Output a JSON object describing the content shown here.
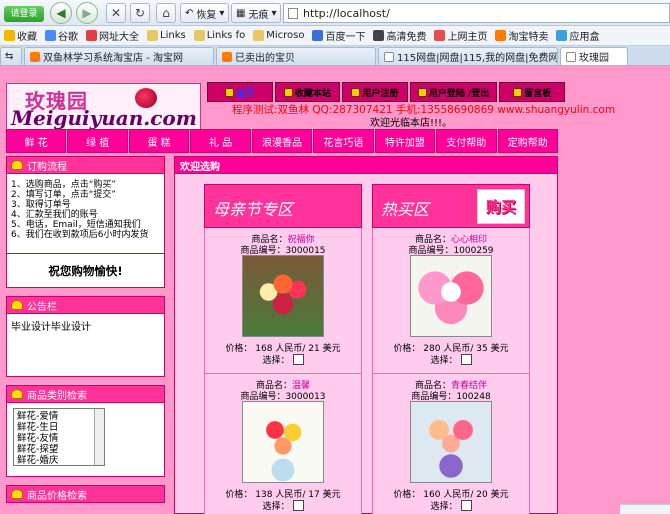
{
  "browser": {
    "login_label": "请登录",
    "back_icon": "back-arrow-icon",
    "forward_icon": "forward-arrow-icon",
    "stop_icon": "close-icon",
    "reload_icon": "reload-icon",
    "home_icon": "home-icon",
    "restore_label": "恢复",
    "no_trace_label": "无痕",
    "url": "http://localhost/",
    "bookmarks": [
      {
        "label": "收藏",
        "color": "#f5b800"
      },
      {
        "label": "谷歌",
        "color": "#4a8af4"
      },
      {
        "label": "网址大全",
        "color": "#e04040"
      },
      {
        "label": "Links",
        "color": "#e8c66a"
      },
      {
        "label": "Links fo",
        "color": "#e8c66a"
      },
      {
        "label": "Microso",
        "color": "#e8c66a"
      },
      {
        "label": "百度一下",
        "color": "#3a6fd8"
      },
      {
        "label": "高清免费",
        "color": "#444444"
      },
      {
        "label": "上网主页",
        "color": "#e05050"
      },
      {
        "label": "淘宝特卖",
        "color": "#ff7a00"
      },
      {
        "label": "应用盒",
        "color": "#3aa0e0"
      }
    ],
    "tabs": [
      {
        "label": "双鱼林学习系统淘宝店 - 淘宝网",
        "active": false
      },
      {
        "label": "已卖出的宝贝",
        "active": false
      },
      {
        "label": "115网盘|网盘|115,我的网盘|免费网络...",
        "active": false
      },
      {
        "label": "玫瑰园",
        "active": true
      }
    ]
  },
  "site": {
    "logo_cn": "玫瑰园",
    "logo_en": "Meiguiyuan.com",
    "top_nav": [
      {
        "label": "首页"
      },
      {
        "label": "收藏本站"
      },
      {
        "label": "用户注册"
      },
      {
        "label": "用户登陆 /登出"
      },
      {
        "label": "留言板"
      }
    ],
    "marquee": "程序测试:双鱼林 QQ:287307421 手机:13558690869 www.shuangyulin.com",
    "welcome": "欢迎光临本店!!!。",
    "categories": [
      "鲜 花",
      "绿 植",
      "蛋 糕",
      "礼 品",
      "浪漫香品",
      "花言巧语",
      "特许加盟",
      "支付帮助",
      "定购帮助"
    ]
  },
  "sidebar": {
    "order_title": "订购流程",
    "order_steps": [
      "1、选购商品，点击“购买”",
      "2、填写订单，点击“提交”",
      "3、取得订单号",
      "4、汇款至我们的账号",
      "5、电话，Email，短信通知我们",
      "6、我们在收到款项后6小时内发货"
    ],
    "happy": "祝您购物愉快!",
    "notice_title": "公告栏",
    "notice_text": "毕业设计毕业设计",
    "search_title": "商品类别检索",
    "category_options": [
      "鲜花-爱情",
      "鲜花-生日",
      "鲜花-友情",
      "鲜花-探望",
      "鲜花-婚庆"
    ],
    "price_title": "商品价格检索"
  },
  "main": {
    "title": "欢迎选购",
    "left_col_title": "母亲节专区",
    "right_col_title": "热买区",
    "buy_label": "购买",
    "name_label": "商品名：",
    "code_label": "商品编号：",
    "price_label": "价格：",
    "rmb_label": "人民币/",
    "usd_label": "美元",
    "select_label": "选择：",
    "left_items": [
      {
        "name": "祝福你",
        "code": "3000015",
        "rmb": "168",
        "usd": "21"
      },
      {
        "name": "温馨",
        "code": "3000013",
        "rmb": "138",
        "usd": "17"
      }
    ],
    "right_items": [
      {
        "name": "心心相印",
        "code": "1000259",
        "rmb": "280",
        "usd": "35"
      },
      {
        "name": "青春结伴",
        "code": "100248",
        "rmb": "160",
        "usd": "20"
      }
    ]
  }
}
